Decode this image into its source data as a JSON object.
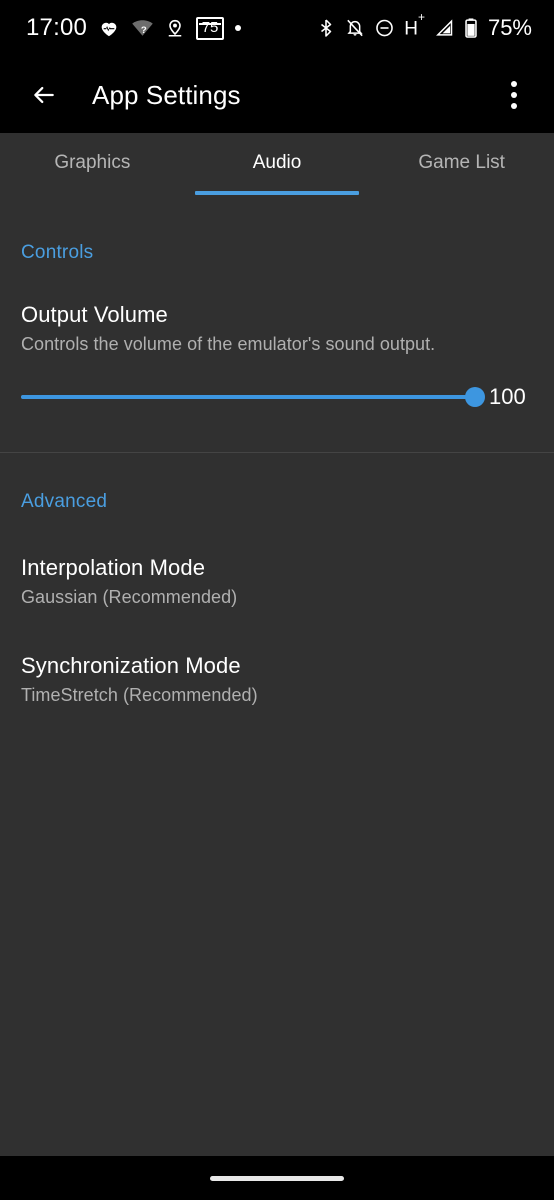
{
  "status_bar": {
    "clock": "17:00",
    "left_icons": [
      {
        "name": "heart-pulse-icon"
      },
      {
        "name": "wifi-unknown-icon"
      },
      {
        "name": "location-pin-icon"
      },
      {
        "name": "badge-75-icon",
        "label": "75"
      },
      {
        "name": "dot-indicator-icon"
      }
    ],
    "right_icons": [
      {
        "name": "bluetooth-icon"
      },
      {
        "name": "notifications-muted-icon"
      },
      {
        "name": "do-not-disturb-icon"
      },
      {
        "name": "network-hplus-icon",
        "label": "H",
        "superscript": "+"
      },
      {
        "name": "signal-strength-icon"
      },
      {
        "name": "battery-icon"
      }
    ],
    "battery_percent": "75%"
  },
  "app_bar": {
    "back_label": "Back",
    "title": "App Settings",
    "overflow_label": "More options"
  },
  "tabs": [
    {
      "label": "Graphics",
      "selected": false
    },
    {
      "label": "Audio",
      "selected": true
    },
    {
      "label": "Game List",
      "selected": false
    }
  ],
  "sections": [
    {
      "header": "Controls",
      "items": [
        {
          "title": "Output Volume",
          "summary": "Controls the volume of the emulator's sound output.",
          "type": "slider",
          "value": "100",
          "min": 0,
          "max": 100
        }
      ]
    },
    {
      "header": "Advanced",
      "items": [
        {
          "title": "Interpolation Mode",
          "summary": "Gaussian (Recommended)",
          "type": "list"
        },
        {
          "title": "Synchronization Mode",
          "summary": "TimeStretch (Recommended)",
          "type": "list"
        }
      ]
    }
  ],
  "colors": {
    "accent": "#4a9ee0",
    "slider": "#3d96e0",
    "background": "#303030",
    "bar_background": "#000000",
    "primary_text": "#ffffff",
    "secondary_text": "#b0b0b0"
  },
  "nav_bar": {
    "gesture_handle": "home-gesture-handle"
  }
}
